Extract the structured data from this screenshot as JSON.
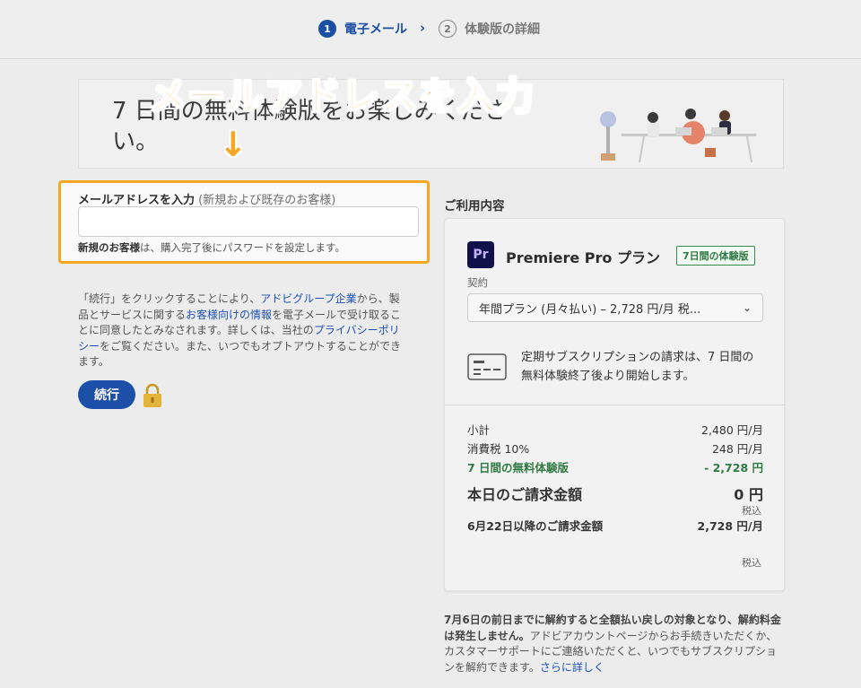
{
  "steps": {
    "step1_num": "1",
    "step1_label": "電子メール",
    "step2_num": "2",
    "step2_label": "体験版の詳細"
  },
  "hero": {
    "text": "7 日間の無料体験版をお楽しみください。"
  },
  "annotation": {
    "callout": "メールアドレスを入力",
    "arrow": "↓"
  },
  "email": {
    "label_bold": "メールアドレスを入力",
    "label_light": " (新規および既存のお客様)",
    "value": "",
    "note_bold": "新規のお客様",
    "note_rest": "は、購入完了後にパスワードを設定します。"
  },
  "consent": {
    "p1": "「続行」をクリックすることにより、",
    "link1": "アドビグループ企業",
    "p2": "から、製品とサービスに関する",
    "link2": "お客様向けの情報",
    "p3": "を電子メールで受け取ることに同意したとみなされます。詳しくは、当社の",
    "link3": "プライバシーポリシー",
    "p4": "をご覧ください。また、いつでもオプトアウトすることができます。"
  },
  "continue_label": "続行",
  "summary": {
    "title": "ご利用内容",
    "logo_text": "Pr",
    "plan_name": "Premiere Pro プラン",
    "trial_badge": "7日間の体験版",
    "contract_label": "契約",
    "plan_select": "年間プラン (月々払い) – 2,728 円/月 税...",
    "billing_note": "定期サブスクリプションの請求は、7 日間の無料体験終了後より開始します。",
    "subtotal_label": "小計",
    "subtotal_value": "2,480 円/月",
    "tax_label": "消費税 10%",
    "tax_value": "248 円/月",
    "trial_label": "7 日間の無料体験版",
    "trial_value": "- 2,728 円",
    "today_label": "本日のご請求金額",
    "today_value": "0 円",
    "today_tax_note": "税込",
    "future_label": "6月22日以降のご請求金額",
    "future_value": "2,728 円/月",
    "future_tax_note": "税込"
  },
  "refund": {
    "bold": "7月6日の前日までに解約すると全額払い戻しの対象となり、解約料金は発生しません。",
    "rest": "アドビアカウントページからお手続きいただくか、カスタマーサポートにご連絡いただくと、いつでもサブスクリプションを解約できます。",
    "link": "さらに詳しく"
  },
  "colors": {
    "accent_blue": "#1c4fa8",
    "annotation_orange": "#f5a623",
    "trial_green": "#2f7a42"
  }
}
